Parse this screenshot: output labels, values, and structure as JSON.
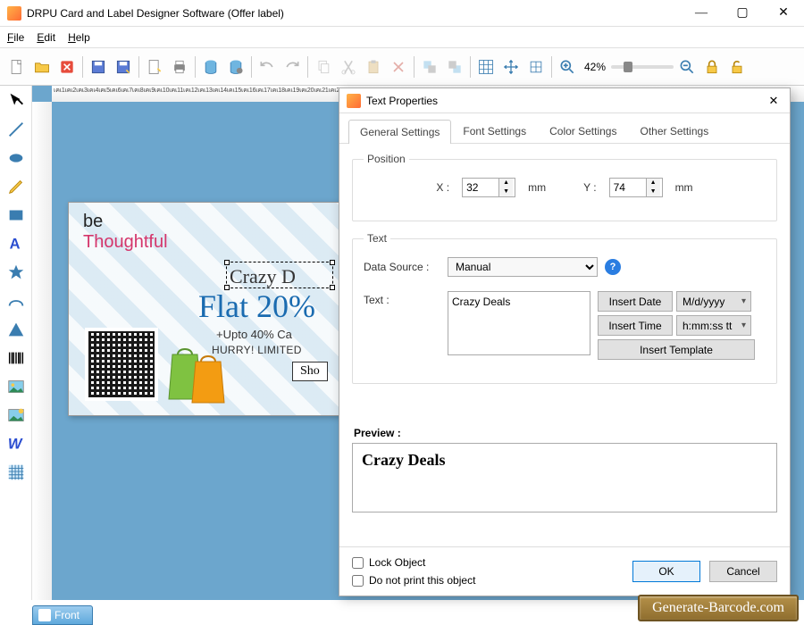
{
  "window": {
    "title": "DRPU Card and Label Designer Software (Offer label)"
  },
  "menu": {
    "file": "File",
    "edit": "Edit",
    "help": "Help"
  },
  "toolbar": {
    "zoom_value": "42%"
  },
  "sidebar_tools": [
    "pointer",
    "line",
    "ellipse",
    "pencil",
    "rect",
    "text",
    "star",
    "arc",
    "triangle",
    "barcode",
    "image",
    "gallery",
    "wordart",
    "pattern"
  ],
  "canvas": {
    "tab_label": "Front",
    "logo_top": "be",
    "logo_script": "Thoughtful",
    "headline": "Crazy D",
    "flat": "Flat 20%",
    "cash": "+Upto 40% Ca",
    "hurry": "HURRY! LIMITED",
    "shop": "Sho"
  },
  "dialog": {
    "title": "Text Properties",
    "tabs": {
      "general": "General Settings",
      "font": "Font Settings",
      "color": "Color Settings",
      "other": "Other Settings"
    },
    "position": {
      "legend": "Position",
      "x_label": "X :",
      "x_value": "32",
      "y_label": "Y :",
      "y_value": "74",
      "unit": "mm"
    },
    "text": {
      "legend": "Text",
      "data_source_label": "Data Source :",
      "data_source_value": "Manual",
      "text_label": "Text :",
      "text_value": "Crazy Deals",
      "insert_date": "Insert Date",
      "date_format": "M/d/yyyy",
      "insert_time": "Insert Time",
      "time_format": "h:mm:ss tt",
      "insert_template": "Insert Template"
    },
    "preview_label": "Preview :",
    "preview_value": "Crazy Deals",
    "lock_label": "Lock Object",
    "noprint_label": "Do not print this object",
    "ok": "OK",
    "cancel": "Cancel"
  },
  "watermark": "Generate-Barcode.com"
}
